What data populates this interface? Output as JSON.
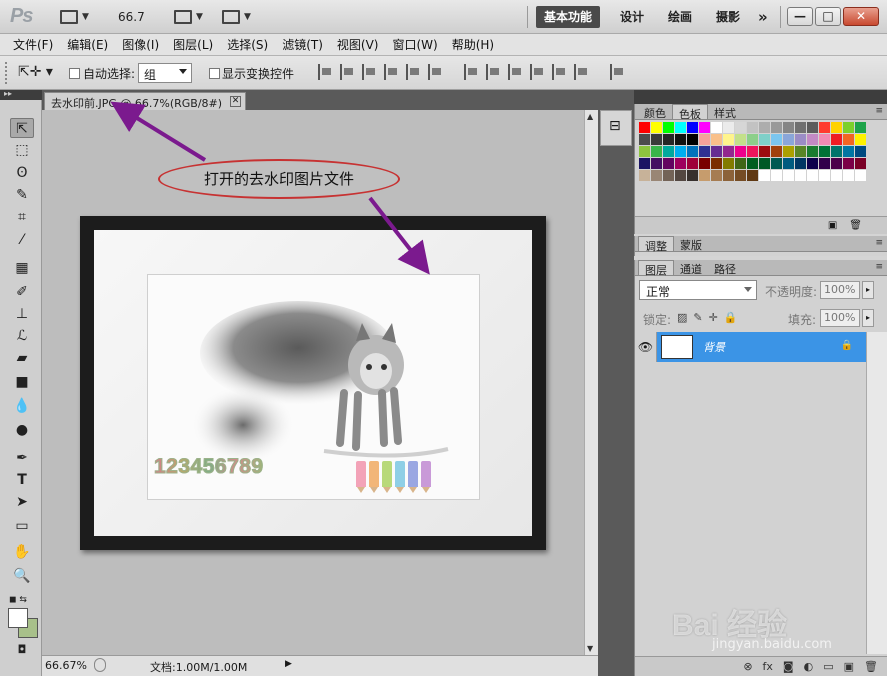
{
  "titlebar": {
    "logo": "Ps",
    "zoom": "66.7",
    "workspaces": [
      "基本功能",
      "设计",
      "绘画",
      "摄影"
    ],
    "more": "»",
    "window_buttons": {
      "minimize": "—",
      "restore": "□",
      "close": "✕"
    }
  },
  "menu": [
    "文件(F)",
    "编辑(E)",
    "图像(I)",
    "图层(L)",
    "选择(S)",
    "滤镜(T)",
    "视图(V)",
    "窗口(W)",
    "帮助(H)"
  ],
  "options": {
    "auto_select_label": "自动选择:",
    "auto_select_value": "组",
    "show_transform_label": "显示变换控件"
  },
  "document": {
    "tab_title": "去水印前.JPG @ 66.7%(RGB/8#)",
    "tab_close": "✕",
    "watermark_numbers": "123456789"
  },
  "annotation": {
    "label": "打开的去水印图片文件"
  },
  "status": {
    "zoom": "66.67%",
    "doc_info": "文档:1.00M/1.00M"
  },
  "panels": {
    "swatches_tabs": [
      "颜色",
      "色板",
      "样式"
    ],
    "adjust_tabs": [
      "调整",
      "蒙版"
    ],
    "layers_tabs": [
      "图层",
      "通道",
      "路径"
    ],
    "blend_mode": "正常",
    "opacity_label": "不透明度:",
    "opacity_value": "100%",
    "lock_label": "锁定:",
    "fill_label": "填充:",
    "fill_value": "100%",
    "layer_name": "背景"
  },
  "colors": {
    "selected_layer": "#3b94e6",
    "annotation_ellipse": "#c73232",
    "arrow": "#7b1a8e"
  },
  "brand": {
    "watermark": "Bai 经验",
    "url": "jingyan.baidu.com"
  }
}
